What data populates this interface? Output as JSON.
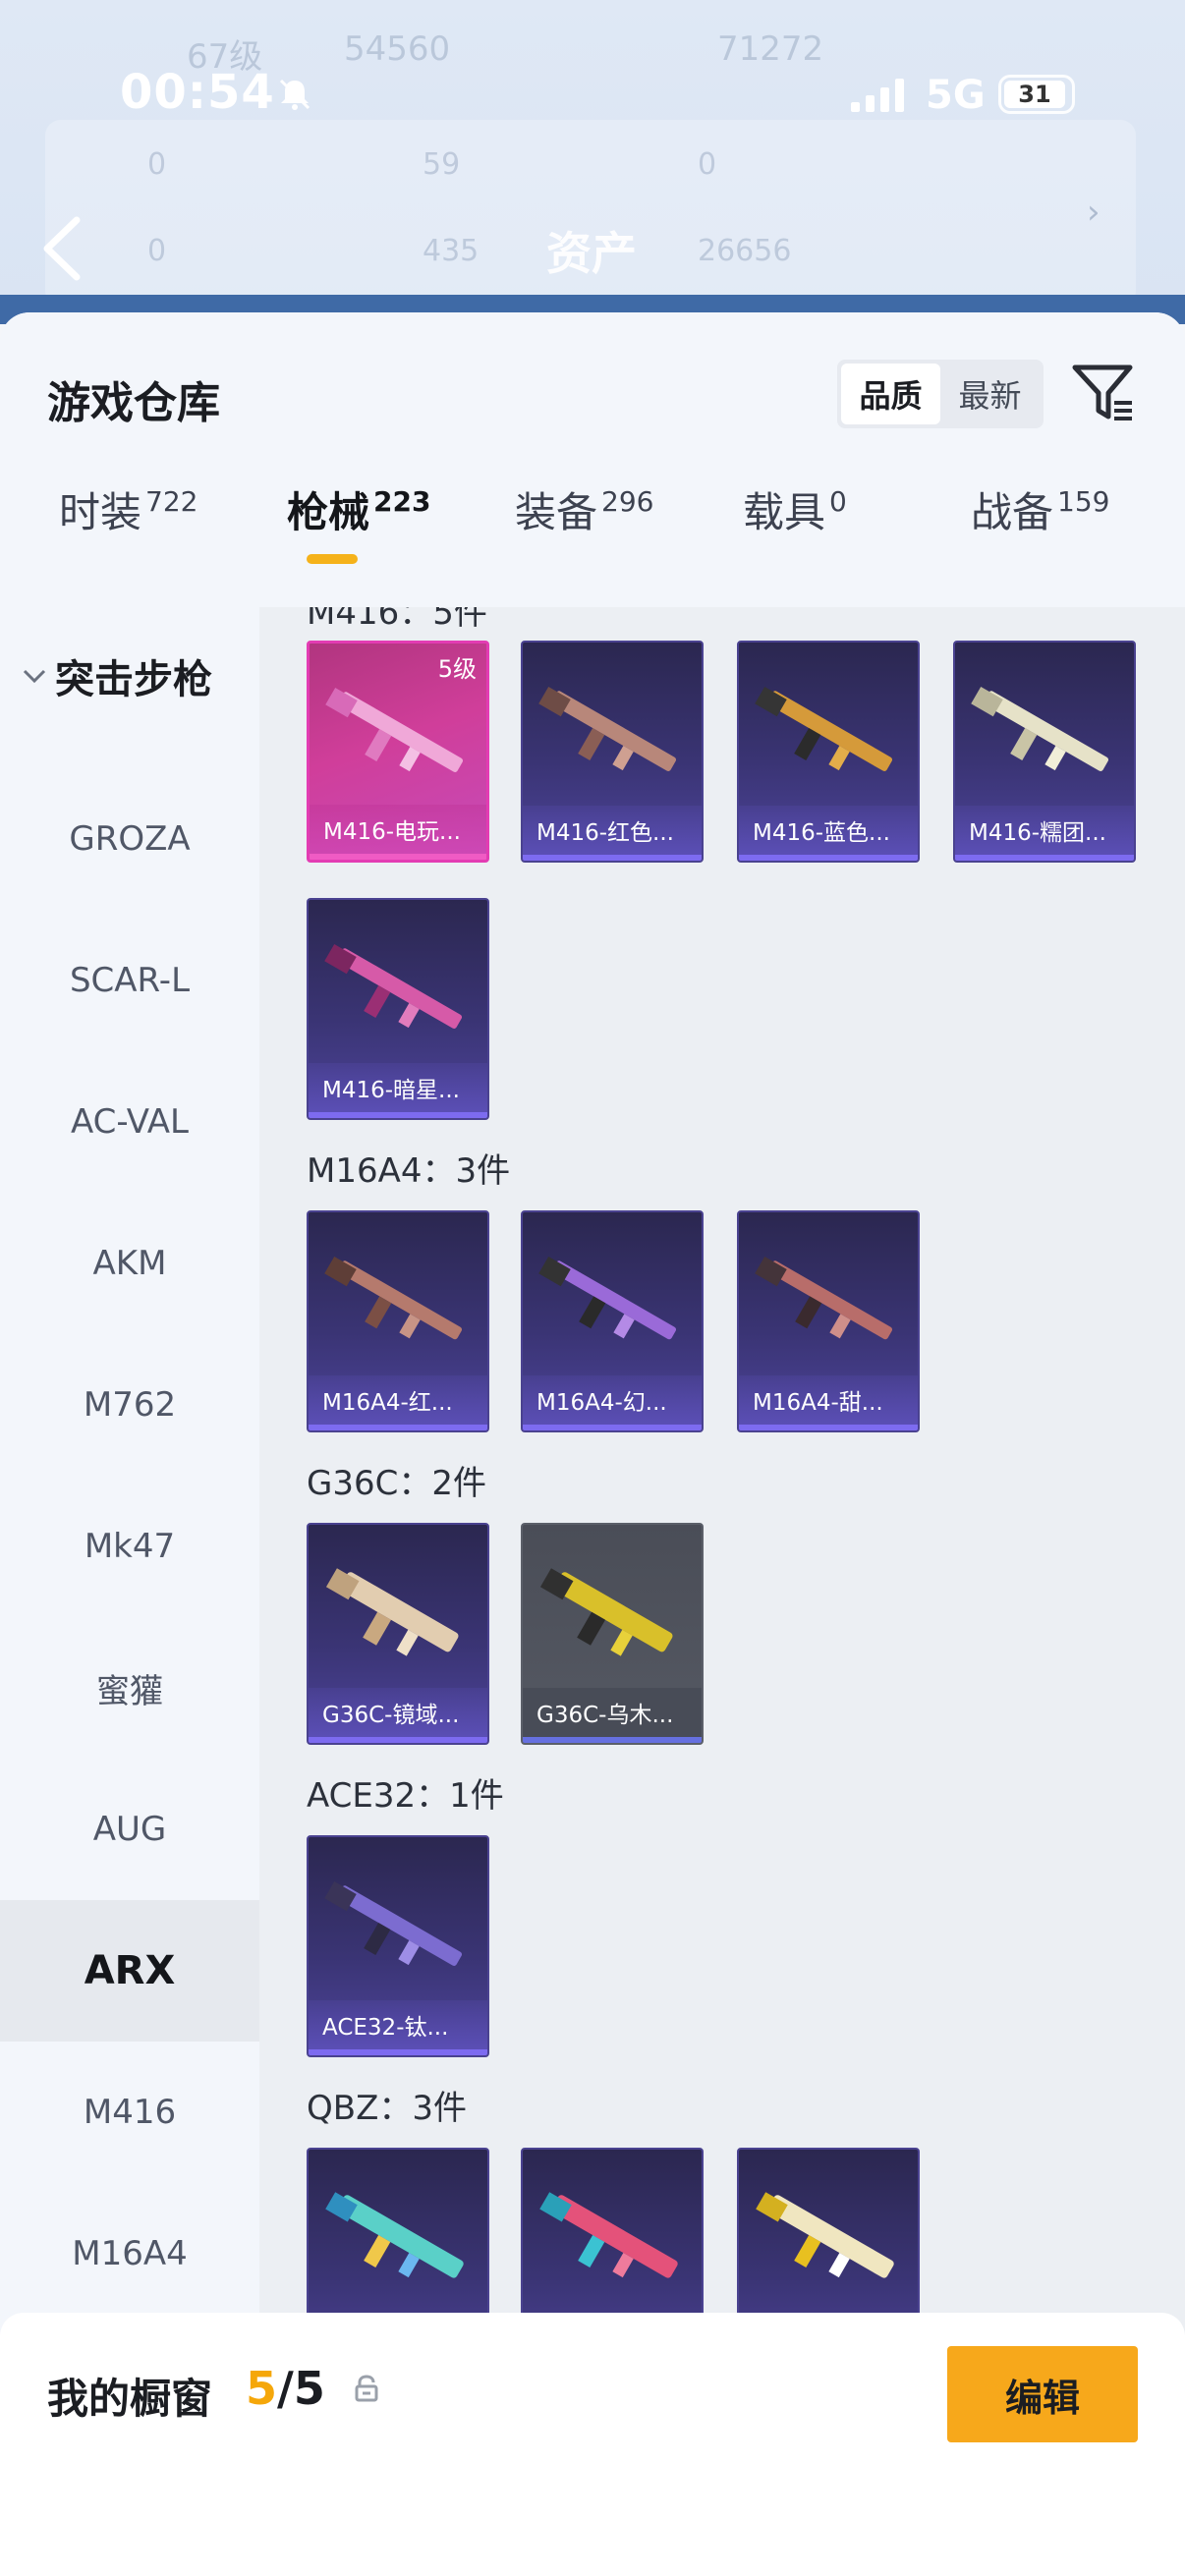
{
  "status_bar": {
    "time": "00:54",
    "network": "5G",
    "battery": "31"
  },
  "background": {
    "title": "资产",
    "ghost_level": "67级",
    "ghost_coins": "54560",
    "ghost_score": "71272",
    "ghost_stats": [
      "0",
      "59",
      "0",
      "0",
      "435",
      "26656"
    ]
  },
  "sheet": {
    "title": "游戏仓库",
    "sort_options": [
      "品质",
      "最新"
    ],
    "tabs": [
      {
        "label": "时装",
        "count": "722"
      },
      {
        "label": "枪械",
        "count": "223"
      },
      {
        "label": "装备",
        "count": "296"
      },
      {
        "label": "载具",
        "count": "0"
      },
      {
        "label": "战备",
        "count": "159"
      }
    ]
  },
  "sidebar": {
    "group": "突击步枪",
    "items": [
      "GROZA",
      "SCAR-L",
      "AC-VAL",
      "AKM",
      "M762",
      "Mk47",
      "蜜獾",
      "AUG",
      "ARX",
      "M416",
      "M16A4"
    ]
  },
  "content": {
    "partial_title": "M416：5件",
    "groups": [
      {
        "title": "M16A4：3件"
      },
      {
        "title": "G36C：2件"
      },
      {
        "title": "ACE32：1件"
      },
      {
        "title": "QBZ：3件"
      }
    ],
    "cards": {
      "m416": [
        {
          "name": "M416-电玩...",
          "level": "5级"
        },
        {
          "name": "M416-红色..."
        },
        {
          "name": "M416-蓝色..."
        },
        {
          "name": "M416-糯团..."
        },
        {
          "name": "M416-暗星..."
        }
      ],
      "m16a4": [
        {
          "name": "M16A4-红..."
        },
        {
          "name": "M16A4-幻..."
        },
        {
          "name": "M16A4-甜..."
        }
      ],
      "g36c": [
        {
          "name": "G36C-镜域..."
        },
        {
          "name": "G36C-乌木..."
        }
      ],
      "ace32": [
        {
          "name": "ACE32-钛..."
        }
      ]
    }
  },
  "bottom_bar": {
    "label": "我的橱窗",
    "current": "5",
    "total": "/5",
    "edit_label": "编辑"
  }
}
